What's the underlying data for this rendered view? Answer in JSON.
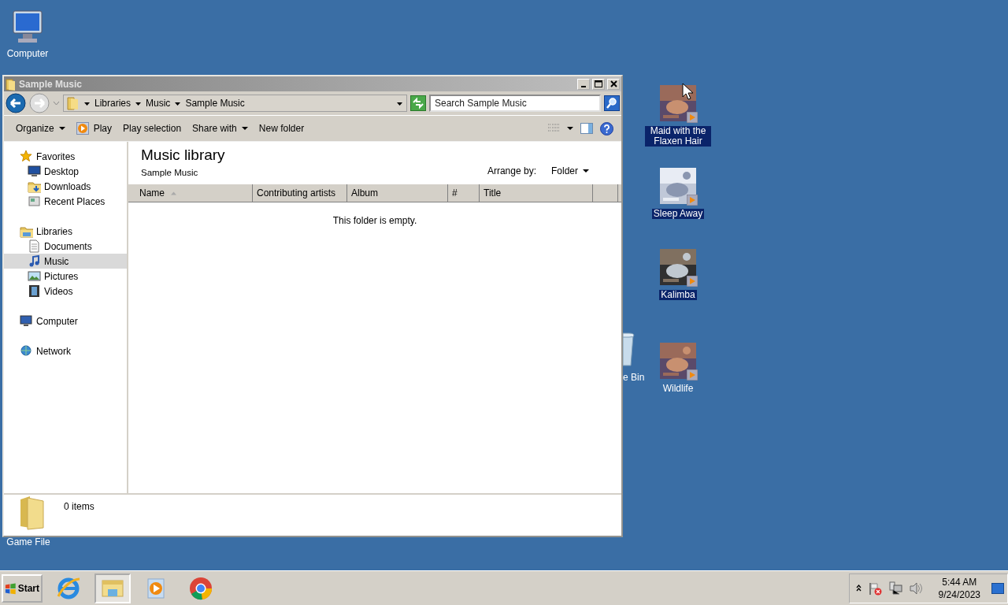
{
  "desktop_icons": [
    {
      "label": "Computer",
      "kind": "computer",
      "selected": false
    },
    {
      "label": "Maid with the Flaxen Hair",
      "kind": "audio",
      "selected": true
    },
    {
      "label": "Sleep Away",
      "kind": "audio",
      "selected": true
    },
    {
      "label": "Kalimba",
      "kind": "audio",
      "selected": true
    },
    {
      "label": "e Bin",
      "kind": "recycle",
      "selected": false
    },
    {
      "label": "Wildlife",
      "kind": "video",
      "selected": false
    },
    {
      "label": "Game File",
      "kind": "file",
      "selected": false
    }
  ],
  "window": {
    "title": "Sample Music",
    "breadcrumb": [
      "Libraries",
      "Music",
      "Sample Music"
    ],
    "search": {
      "placeholder": "Search Sample Music"
    },
    "toolbar": [
      {
        "label": "Organize",
        "dropdown": true,
        "icon": false
      },
      {
        "label": "Play",
        "dropdown": false,
        "icon": true
      },
      {
        "label": "Play selection",
        "dropdown": false,
        "icon": false
      },
      {
        "label": "Share with",
        "dropdown": true,
        "icon": false
      },
      {
        "label": "New folder",
        "dropdown": false,
        "icon": false
      }
    ],
    "sidebar": [
      {
        "label": "Favorites",
        "kind": "star",
        "selected": false,
        "children": [
          {
            "label": "Desktop",
            "kind": "desktop",
            "selected": false
          },
          {
            "label": "Downloads",
            "kind": "downloads",
            "selected": false
          },
          {
            "label": "Recent Places",
            "kind": "recent",
            "selected": false
          }
        ]
      },
      {
        "label": "Libraries",
        "kind": "library",
        "selected": false,
        "children": [
          {
            "label": "Documents",
            "kind": "documents",
            "selected": false
          },
          {
            "label": "Music",
            "kind": "music",
            "selected": true
          },
          {
            "label": "Pictures",
            "kind": "pictures",
            "selected": false
          },
          {
            "label": "Videos",
            "kind": "videos",
            "selected": false
          }
        ]
      },
      {
        "label": "Computer",
        "kind": "computer",
        "selected": false
      },
      {
        "label": "Network",
        "kind": "network",
        "selected": false
      }
    ],
    "library": {
      "title": "Music library",
      "subtitle": "Sample Music",
      "arrange_label": "Arrange by:",
      "arrange_value": "Folder"
    },
    "columns": [
      {
        "label": "Name",
        "sorted": true
      },
      {
        "label": "Contributing artists",
        "sorted": false
      },
      {
        "label": "Album",
        "sorted": false
      },
      {
        "label": "#",
        "sorted": false
      },
      {
        "label": "Title",
        "sorted": false
      }
    ],
    "empty_message": "This folder is empty.",
    "status": "0 items"
  },
  "taskbar": {
    "start": "Start",
    "apps": [
      {
        "kind": "ie",
        "active": false
      },
      {
        "kind": "explorer",
        "active": true
      },
      {
        "kind": "mediaplayer",
        "active": false
      },
      {
        "kind": "chrome",
        "active": false
      }
    ],
    "time": "5:44 AM",
    "date": "9/24/2023"
  }
}
